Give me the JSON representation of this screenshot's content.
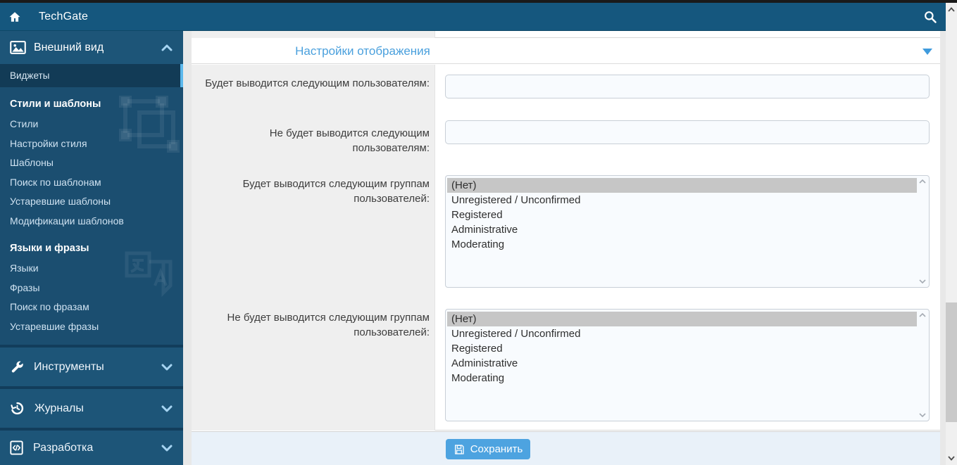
{
  "topbar": {
    "brand": "TechGate",
    "icons": {
      "home": "home-icon",
      "search": "search-icon"
    }
  },
  "sidebar": {
    "appearance_section": {
      "label": "Внешний вид",
      "icon": "image-icon",
      "state": "expanded"
    },
    "active_item": {
      "label": "Виджеты"
    },
    "groups": [
      {
        "header": "Стили и шаблоны",
        "items": [
          "Стили",
          "Настройки стиля",
          "Шаблоны",
          "Поиск по шаблонам",
          "Устаревшие шаблоны",
          "Модификации шаблонов"
        ]
      },
      {
        "header": "Языки и фразы",
        "items": [
          "Языки",
          "Фразы",
          "Поиск по фразам",
          "Устаревшие фразы"
        ]
      }
    ],
    "collapsed_sections": [
      {
        "label": "Инструменты",
        "icon": "wrench-icon",
        "state": "collapsed"
      },
      {
        "label": "Журналы",
        "icon": "history-icon",
        "state": "collapsed"
      },
      {
        "label": "Разработка",
        "icon": "code-icon",
        "state": "collapsed"
      }
    ]
  },
  "content": {
    "section_title": "Настройки отображения",
    "fields": [
      {
        "label": "Будет выводится следующим пользователям:",
        "type": "text",
        "value": ""
      },
      {
        "label": "Не будет выводится следующим пользователям:",
        "type": "text",
        "value": ""
      },
      {
        "label": "Будет выводится следующим группам пользователей:",
        "type": "multiselect",
        "selected": "(Нет)",
        "options": [
          "(Нет)",
          "Unregistered / Unconfirmed",
          "Registered",
          "Administrative",
          "Moderating"
        ]
      },
      {
        "label": "Не будет выводится следующим группам пользователей:",
        "type": "multiselect",
        "selected": "(Нет)",
        "options": [
          "(Нет)",
          "Unregistered / Unconfirmed",
          "Registered",
          "Administrative",
          "Moderating"
        ]
      }
    ],
    "save_button": {
      "label": "Сохранить",
      "icon": "save-icon"
    }
  },
  "colors": {
    "topbar": "#15577E",
    "sidebar": "#1B4E70",
    "sidebar_band": "#1D5578",
    "sidebar_active": "#123B56",
    "active_indicator": "#5CB8EC",
    "accent_title": "#4AA0DD",
    "save_button": "#4DA3E0",
    "selected_option": "#C6C6C6",
    "footer": "#E9F1F9",
    "label_column": "#EFEFEF"
  }
}
